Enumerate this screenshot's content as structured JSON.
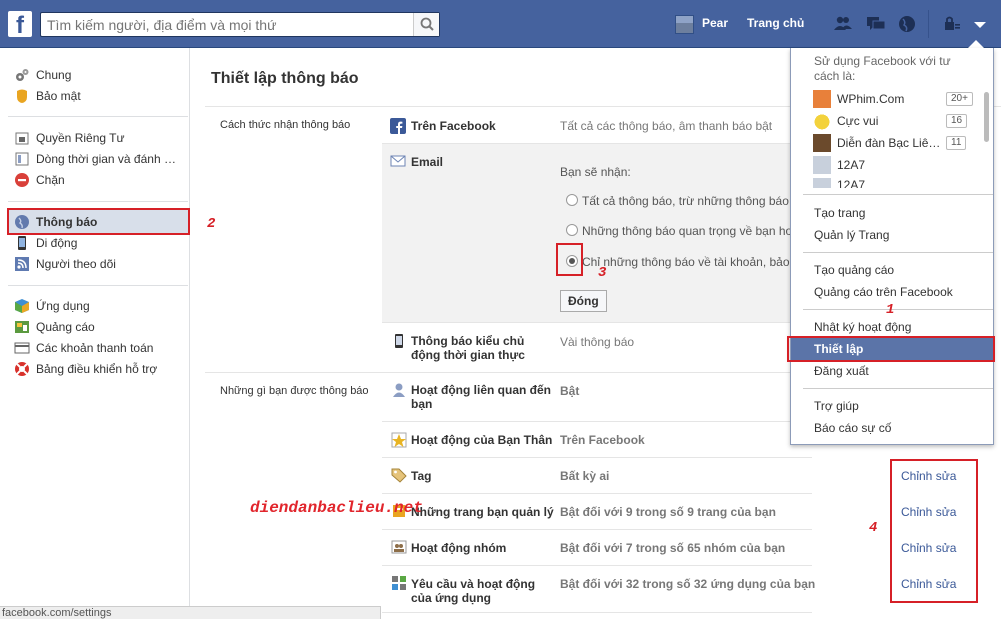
{
  "topbar": {
    "logo": "f",
    "search_placeholder": "Tìm kiếm người, địa điểm và mọi thứ",
    "profile_name": "Pear",
    "home_label": "Trang chủ"
  },
  "sidebar": {
    "groups": [
      [
        {
          "label": "Chung",
          "icon": "gears-icon"
        },
        {
          "label": "Bảo mật",
          "icon": "shield-icon"
        }
      ],
      [
        {
          "label": "Quyền Riêng Tư",
          "icon": "lock-icon"
        },
        {
          "label": "Dòng thời gian và đánh …",
          "icon": "timeline-icon"
        },
        {
          "label": "Chặn",
          "icon": "block-icon"
        }
      ],
      [
        {
          "label": "Thông báo",
          "icon": "globe-icon"
        },
        {
          "label": "Di động",
          "icon": "mobile-icon"
        },
        {
          "label": "Người theo dõi",
          "icon": "rss-icon"
        }
      ],
      [
        {
          "label": "Ứng dụng",
          "icon": "apps-icon"
        },
        {
          "label": "Quảng cáo",
          "icon": "ads-icon"
        },
        {
          "label": "Các khoản thanh toán",
          "icon": "card-icon"
        },
        {
          "label": "Bảng điều khiển hỗ trợ",
          "icon": "lifebuoy-icon"
        }
      ]
    ]
  },
  "main": {
    "title": "Thiết lập thông báo",
    "section1_label": "Cách thức nhận thông báo",
    "section2_label": "Những gì bạn được thông báo",
    "on_facebook": {
      "name": "Trên Facebook",
      "value": "Tất cả các thông báo, âm thanh báo bật"
    },
    "email": {
      "name": "Email",
      "prompt": "Bạn sẽ nhận:",
      "options": [
        "Tất cả thông báo, trừ những thông báo",
        "Những thông báo quan trọng về bạn ho",
        "Chỉ những thông báo về tài khoản, bảo"
      ],
      "selected_index": 2,
      "close_button": "Đóng"
    },
    "push": {
      "name": "Thông báo kiểu chủ động thời gian thực",
      "value": "Vài thông báo"
    },
    "rows": [
      {
        "name": "Hoạt động liên quan đến bạn",
        "value": "Bật",
        "edit": ""
      },
      {
        "name": "Hoạt động của Bạn Thân",
        "value": "Trên Facebook",
        "edit": ""
      },
      {
        "name": "Tag",
        "value": "Bất kỳ ai",
        "edit": "Chỉnh sửa"
      },
      {
        "name": "Những trang bạn quản lý",
        "value": "Bật đối với 9 trong số 9 trang của bạn",
        "edit": "Chỉnh sửa"
      },
      {
        "name": "Hoạt động nhóm",
        "value": "Bật đối với 7 trong số 65 nhóm của bạn",
        "edit": "Chỉnh sửa"
      },
      {
        "name": "Yêu cầu và hoạt động của ứng dụng",
        "value": "Bật đối với 32 trong số 32 ứng dụng của bạn",
        "edit": "Chỉnh sửa"
      }
    ]
  },
  "dropdown": {
    "header": "Sử dụng Facebook với tư cách là:",
    "pages": [
      {
        "name": "WPhim.Com",
        "badge": "20+"
      },
      {
        "name": "Cực vui",
        "badge": "16"
      },
      {
        "name": "Diễn đàn Bạc Liê…",
        "badge": "11"
      },
      {
        "name": "12A7",
        "badge": ""
      },
      {
        "name": "12A7",
        "badge": ""
      }
    ],
    "group1": [
      "Tạo trang",
      "Quản lý Trang"
    ],
    "group2": [
      "Tạo quảng cáo",
      "Quảng cáo trên Facebook"
    ],
    "group3": [
      "Nhật ký hoạt động",
      "Thiết lập",
      "Đăng xuất"
    ],
    "group4": [
      "Trợ giúp",
      "Báo cáo sự cố"
    ]
  },
  "annotations": {
    "n1": "1",
    "n2": "2",
    "n3": "3",
    "n4": "4",
    "watermark": "diendanbaclieu.net"
  },
  "statusbar": "facebook.com/settings",
  "colors": {
    "topbar": "#45629e",
    "link": "#3b5998",
    "highlight": "#d62027",
    "active_menu": "#5b74a8"
  }
}
